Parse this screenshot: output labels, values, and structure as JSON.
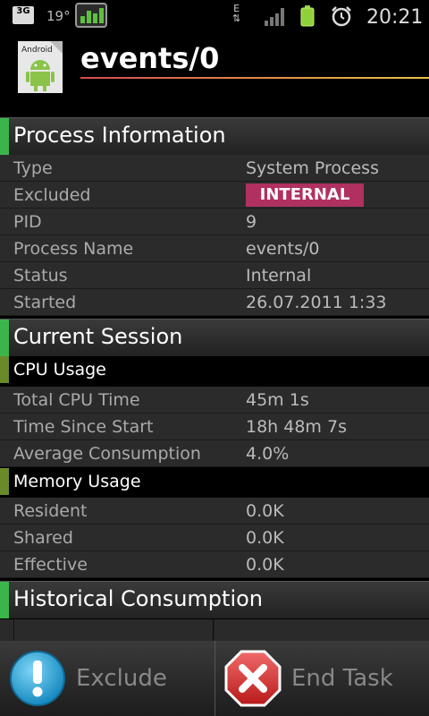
{
  "status_bar": {
    "network_label": "3G",
    "temperature": "19°",
    "data_indicator": "E",
    "time": "20:21",
    "icons": [
      "3g-icon",
      "cpu-monitor-icon",
      "edge-data-icon",
      "signal-icon",
      "battery-icon",
      "alarm-clock-icon"
    ]
  },
  "header": {
    "icon_label": "Android",
    "title": "events/0"
  },
  "sections": {
    "process_info": {
      "title": "Process Information",
      "rows": [
        {
          "label": "Type",
          "value": "System Process"
        },
        {
          "label": "Excluded",
          "value": "INTERNAL"
        },
        {
          "label": "PID",
          "value": "9"
        },
        {
          "label": "Process Name",
          "value": "events/0"
        },
        {
          "label": "Status",
          "value": "Internal"
        },
        {
          "label": "Started",
          "value": "26.07.2011 1:33"
        }
      ]
    },
    "current_session": {
      "title": "Current Session",
      "cpu": {
        "title": "CPU Usage",
        "rows": [
          {
            "label": "Total CPU Time",
            "value": "45m 1s"
          },
          {
            "label": "Time Since Start",
            "value": "18h 48m 7s"
          },
          {
            "label": "Average Consumption",
            "value": "4.0%"
          }
        ]
      },
      "memory": {
        "title": "Memory Usage",
        "rows": [
          {
            "label": "Resident",
            "value": "0.0K"
          },
          {
            "label": "Shared",
            "value": "0.0K"
          },
          {
            "label": "Effective",
            "value": "0.0K"
          }
        ]
      }
    },
    "historical": {
      "title": "Historical Consumption"
    }
  },
  "buttons": {
    "exclude": "Exclude",
    "end_task": "End Task"
  },
  "colors": {
    "accent_green": "#3bb54a",
    "badge": "#b03060",
    "exclude_icon": "#1ba3d9",
    "end_task_icon": "#d42a2a"
  }
}
